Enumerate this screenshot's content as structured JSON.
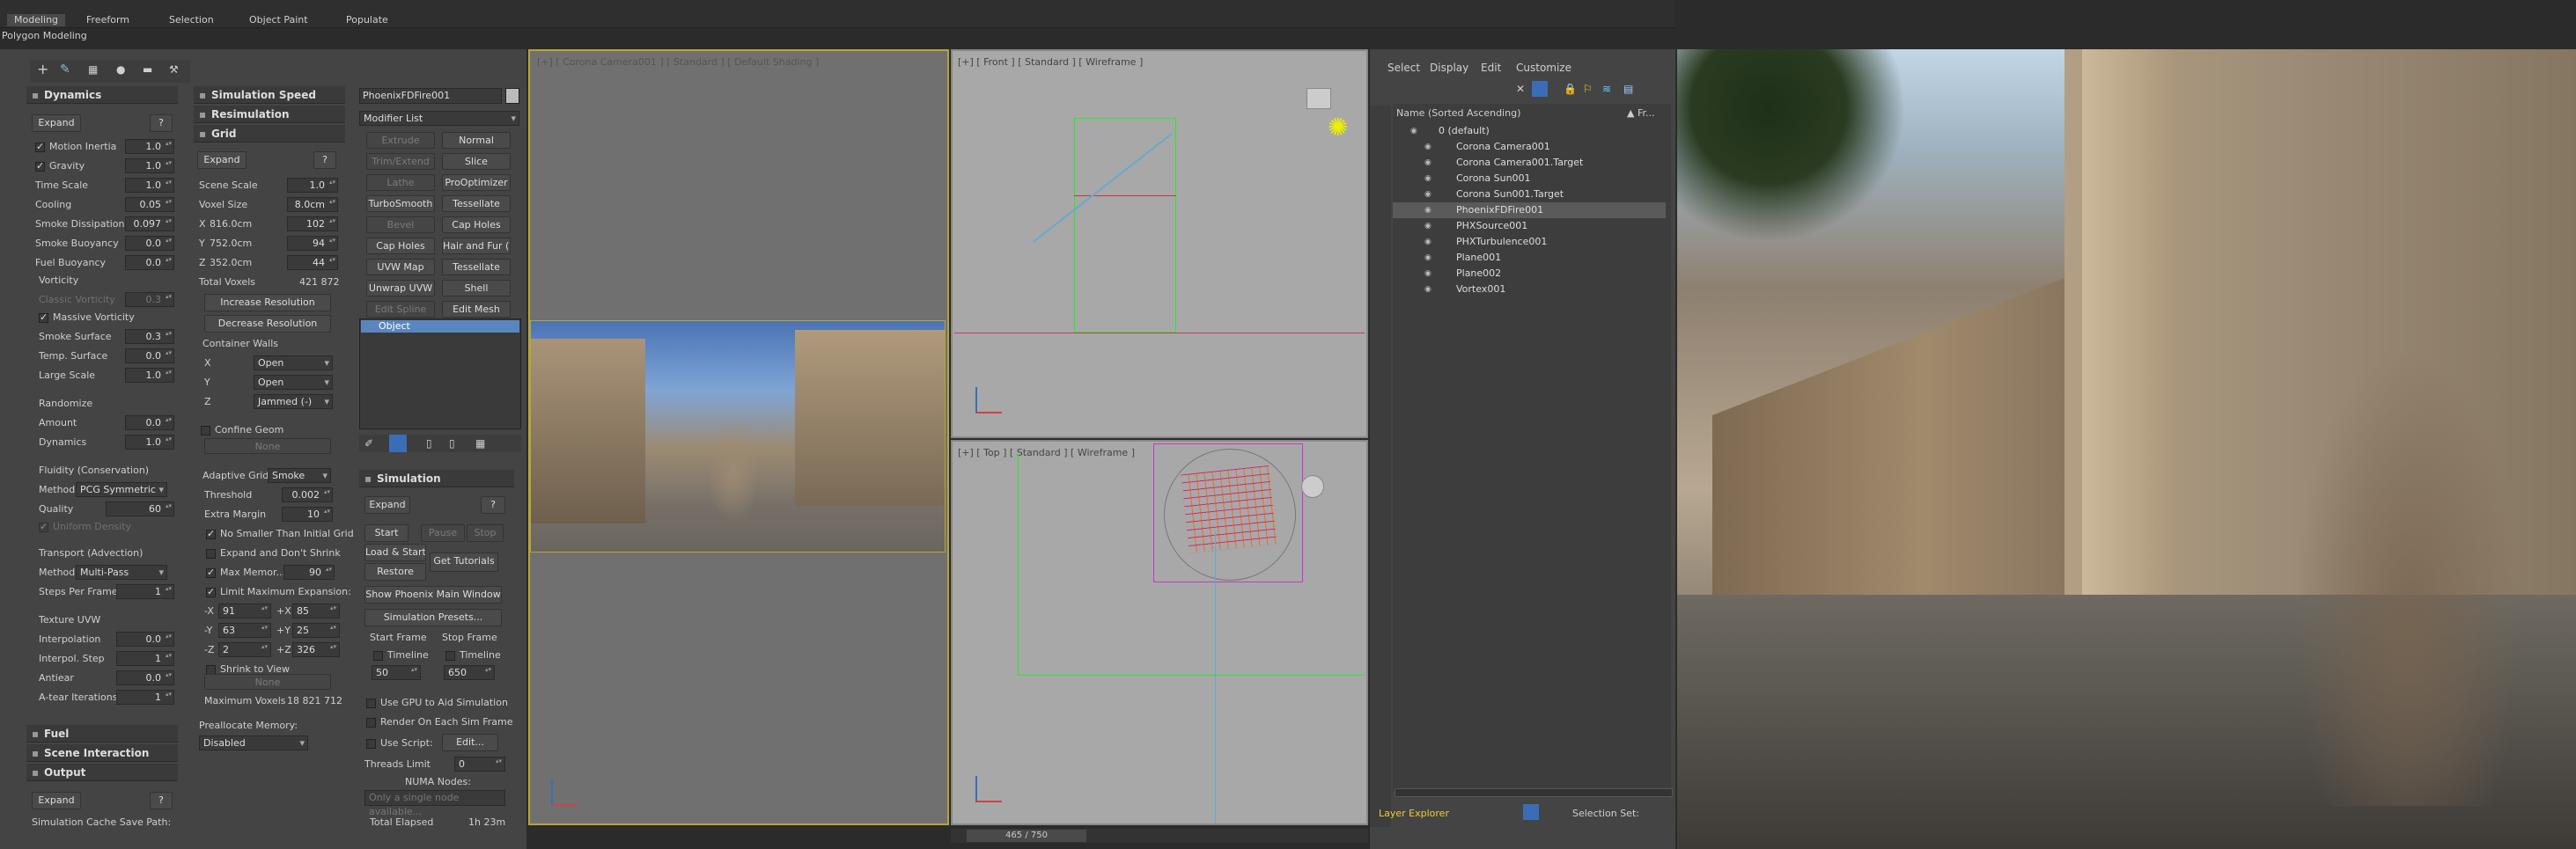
{
  "ribbon": {
    "tabs": [
      "Modeling",
      "Freeform",
      "Selection",
      "Object Paint",
      "Populate"
    ],
    "sub": "Polygon Modeling"
  },
  "dyn": {
    "title": "Dynamics",
    "expand": "Expand",
    "q": "?",
    "motion_inertia": "Motion Inertia",
    "motion_inertia_v": "1.0",
    "gravity": "Gravity",
    "gravity_v": "1.0",
    "time_scale": "Time Scale",
    "time_scale_v": "1.0",
    "cooling": "Cooling",
    "cooling_v": "0.05",
    "smoke_diss": "Smoke Dissipation",
    "smoke_diss_v": "0.097",
    "smoke_buoy": "Smoke Buoyancy",
    "smoke_buoy_v": "0.0",
    "fuel_buoy": "Fuel Buoyancy",
    "fuel_buoy_v": "0.0",
    "vorticity": "Vorticity",
    "classic": "Classic Vorticity",
    "classic_v": "0.3",
    "massive": "Massive Vorticity",
    "smoke_surface": "Smoke Surface",
    "smoke_surface_v": "0.3",
    "temp_surface": "Temp. Surface",
    "temp_surface_v": "0.0",
    "large_scale": "Large Scale",
    "large_scale_v": "1.0",
    "randomize": "Randomize",
    "amount": "Amount",
    "amount_v": "0.0",
    "dynamics": "Dynamics",
    "dynamics_v": "1.0",
    "fluidity": "Fluidity (Conservation)",
    "method": "Method",
    "method_v": "PCG Symmetric",
    "quality": "Quality",
    "quality_v": "60",
    "uniform": "Uniform Density",
    "transport": "Transport (Advection)",
    "method2_v": "Multi-Pass",
    "steps": "Steps Per Frame",
    "steps_v": "1",
    "texuvw": "Texture UVW",
    "interp": "Interpolation",
    "interp_v": "0.0",
    "interp_step": "Interpol. Step",
    "interp_step_v": "1",
    "antiear": "Antiear",
    "antiear_v": "0.0",
    "atear": "A-tear Iterations",
    "atear_v": "1",
    "fuel": "Fuel",
    "scene_int": "Scene Interaction",
    "output": "Output",
    "expand2": "Expand",
    "cutoff": "Simulation Cache Save Path:"
  },
  "mid": {
    "sim_speed": "Simulation Speed",
    "resim": "Resimulation",
    "grid": "Grid",
    "expand": "Expand",
    "q": "?",
    "scene_scale": "Scene Scale",
    "scene_scale_v": "1.0",
    "voxel": "Voxel Size",
    "voxel_v": "8.0cm",
    "x": "X",
    "x_v": "816.0cm",
    "x_n": "102",
    "y": "Y",
    "y_v": "752.0cm",
    "y_n": "94",
    "z": "Z",
    "z_v": "352.0cm",
    "z_n": "44",
    "total": "Total Voxels",
    "total_v": "421 872",
    "inc": "Increase Resolution",
    "dec": "Decrease Resolution",
    "walls": "Container Walls",
    "wx": "X",
    "wx_v": "Open",
    "wy": "Y",
    "wy_v": "Open",
    "wz": "Z",
    "wz_v": "Jammed (-)",
    "confine": "Confine Geom",
    "none": "None",
    "adaptive": "Adaptive Grid",
    "adaptive_v": "Smoke",
    "threshold": "Threshold",
    "threshold_v": "0.002",
    "extra": "Extra Margin",
    "extra_v": "10",
    "nosmaller": "No Smaller Than Initial Grid",
    "expdont": "Expand and Don't Shrink",
    "maxmem": "Max Memor...",
    "maxmem_v": "90",
    "limit": "Limit Maximum Expansion:",
    "mx": "-X",
    "mx_v": "91",
    "px": "+X",
    "px_v": "85",
    "my": "-Y",
    "my_v": "63",
    "py": "+Y",
    "py_v": "25",
    "mz": "-Z",
    "mz_v": "2",
    "pz": "+Z",
    "pz_v": "326",
    "shrink": "Shrink to View",
    "none2": "None",
    "maxvox": "Maximum Voxels",
    "maxvox_v": "18 821 712",
    "prealloc": "Preallocate Memory:",
    "prealloc_v": "Disabled"
  },
  "mod": {
    "name": "PhoenixFDFire001",
    "list": "Modifier List",
    "b": [
      [
        "Extrude",
        "Normal"
      ],
      [
        "Trim/Extend",
        "Slice"
      ],
      [
        "Lathe",
        "ProOptimizer"
      ],
      [
        "TurboSmooth",
        "Tessellate"
      ],
      [
        "Bevel",
        "Cap Holes"
      ],
      [
        "Cap Holes",
        "Hair and Fur (WSM)"
      ],
      [
        "UVW Map",
        "Tessellate"
      ],
      [
        "Unwrap UVW",
        "Shell"
      ],
      [
        "Edit Spline",
        "Edit Mesh"
      ]
    ],
    "stack": "Object"
  },
  "sim": {
    "title": "Simulation",
    "expand": "Expand",
    "q": "?",
    "start": "Start",
    "pause": "Pause",
    "stop": "Stop",
    "loadstart": "Load & Start",
    "restore": "Restore",
    "tutorials": "Get Tutorials",
    "show": "Show Phoenix Main Window",
    "presets": "Simulation Presets...",
    "startf": "Start Frame",
    "stopf": "Stop Frame",
    "timeline": "Timeline",
    "timeline2": "Timeline",
    "startf_v": "50",
    "stopf_v": "650",
    "gpu": "Use GPU to Aid Simulation",
    "render": "Render On Each Sim Frame",
    "script": "Use Script:",
    "edit": "Edit...",
    "threads": "Threads Limit",
    "threads_v": "0",
    "numa": "NUMA Nodes:",
    "numa_hint": "Only a single node available...",
    "total": "Total Elapsed",
    "total_v": "1h 23m"
  },
  "vp": {
    "cam": "[+] [ Corona Camera001 ] [ Standard ] [ Default Shading ]",
    "front": "[+] [ Front ] [ Standard ] [ Wireframe ]",
    "top": "[+] [ Top ] [ Standard ] [ Wireframe ]",
    "timeline": "465 / 750"
  },
  "explorer": {
    "menu": [
      "Select",
      "Display",
      "Edit",
      "Customize"
    ],
    "col_name": "Name (Sorted Ascending)",
    "col_fr": "▲ Fr...",
    "items": [
      "0 (default)",
      "Corona Camera001",
      "Corona Camera001.Target",
      "Corona Sun001",
      "Corona Sun001.Target",
      "PhoenixFDFire001",
      "PHXSource001",
      "PHXTurbulence001",
      "Plane001",
      "Plane002",
      "Vortex001"
    ],
    "layer_explorer": "Layer Explorer",
    "selection_set": "Selection Set:"
  },
  "colors": {
    "accent": "#3a6db5",
    "viewport_border": "#b6a53a",
    "bg": "#444444"
  }
}
